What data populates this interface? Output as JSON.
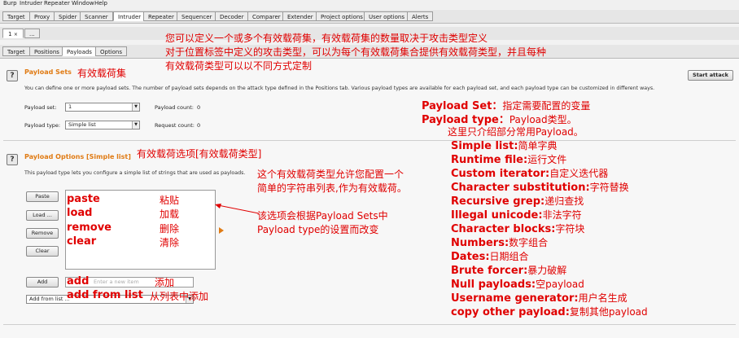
{
  "menu": [
    "Burp",
    "Intruder",
    "Repeater",
    "Window",
    "Help"
  ],
  "top_tabs": [
    "Target",
    "Proxy",
    "Spider",
    "Scanner",
    "Intruder",
    "Repeater",
    "Sequencer",
    "Decoder",
    "Comparer",
    "Extender",
    "Project options",
    "User options",
    "Alerts"
  ],
  "attack_tabs": {
    "number": "1",
    "more": "..."
  },
  "sub_tabs": [
    "Target",
    "Positions",
    "Payloads",
    "Options"
  ],
  "payload_sets": {
    "title": "Payload Sets",
    "annotation": "有效载荷集",
    "description": "You can define one or more payload sets. The number of payload sets depends on the attack type defined in the Positions tab. Various payload types are available for each payload set, and each payload type can be customized in different ways.",
    "start_attack": "Start attack",
    "payload_set_label": "Payload set:",
    "payload_set_value": "1",
    "payload_type_label": "Payload type:",
    "payload_type_value": "Simple list",
    "payload_count_label": "Payload count:",
    "payload_count_value": "0",
    "request_count_label": "Request count:",
    "request_count_value": "0"
  },
  "payload_options": {
    "title": "Payload Options [Simple list]",
    "annotation": "有效载荷选项[有效载荷类型]",
    "description": "This payload type lets you configure a simple list of strings that are used as payloads.",
    "buttons": {
      "paste": "Paste",
      "load": "Load ...",
      "remove": "Remove",
      "clear": "Clear",
      "add": "Add"
    },
    "new_item_placeholder": "Enter a new item",
    "add_from_list": "Add from list ..."
  },
  "annotations": {
    "top_lines": [
      "您可以定义一个或多个有效载荷集，有效载荷集的数量取决于攻击类型定义",
      "对于位置标签中定义的攻击类型，可以为每个有效载荷集合提供有效载荷类型，并且每种",
      "有效载荷类型可以以不同方式定制"
    ],
    "simple_list_lines": [
      "这个有效载荷类型允许您配置一个",
      "简单的字符串列表,作为有效载荷。"
    ],
    "list_note_lines": [
      "该选项会根据Payload Sets中",
      "Payload type的设置而改变"
    ],
    "buttons_cn": [
      {
        "en": "paste",
        "cn": "粘贴"
      },
      {
        "en": "load",
        "cn": "加载"
      },
      {
        "en": "remove",
        "cn": "删除"
      },
      {
        "en": "clear",
        "cn": "清除"
      }
    ],
    "add_cn": {
      "en": "add",
      "cn": "添加"
    },
    "add_from_list_cn": {
      "en": "add from list",
      "cn": "从列表中添加"
    },
    "right": {
      "payload_set": {
        "k": "Payload Set：",
        "v": "指定需要配置的变量"
      },
      "payload_type": {
        "k": "Payload type：",
        "v": "Payload类型。"
      },
      "note": "这里只介绍部分常用Payload。",
      "types": [
        {
          "k": "Simple list:",
          "v": "简单字典"
        },
        {
          "k": "Runtime file:",
          "v": "运行文件"
        },
        {
          "k": "Custom iterator:",
          "v": "自定义迭代器"
        },
        {
          "k": "Character substitution:",
          "v": "字符替换"
        },
        {
          "k": "Recursive grep:",
          "v": "递归查找"
        },
        {
          "k": "Illegal unicode:",
          "v": "非法字符"
        },
        {
          "k": "Character blocks:",
          "v": "字符块"
        },
        {
          "k": "Numbers:",
          "v": "数字组合"
        },
        {
          "k": "Dates:",
          "v": "日期组合"
        },
        {
          "k": "Brute forcer:",
          "v": "暴力破解"
        },
        {
          "k": "Null payloads:",
          "v": "空payload"
        },
        {
          "k": "Username generator:",
          "v": "用户名生成"
        },
        {
          "k": "copy other payload:",
          "v": "复制其他payload"
        }
      ]
    }
  },
  "colors": {
    "annotation_red": "#e00000",
    "section_orange": "#e07b14"
  }
}
